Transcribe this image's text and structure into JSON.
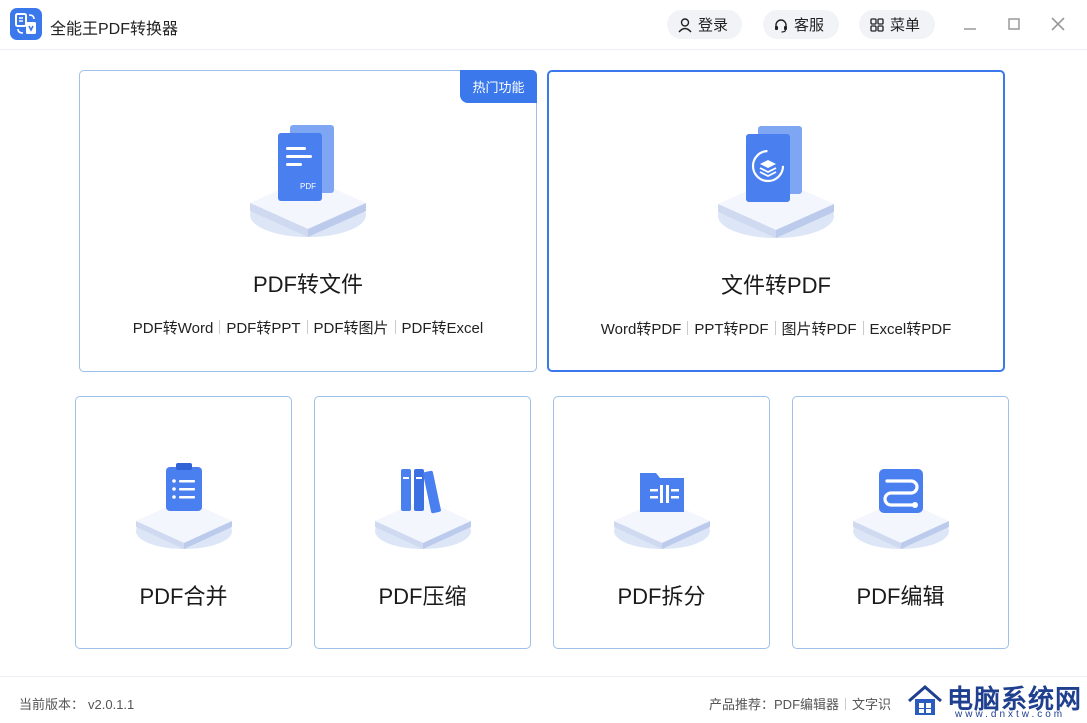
{
  "app": {
    "title": "全能王PDF转换器",
    "accent": "#3a78ec"
  },
  "header": {
    "login_label": "登录",
    "service_label": "客服",
    "menu_label": "菜单"
  },
  "cards": {
    "pdf_to_file": {
      "badge": "热门功能",
      "title": "PDF转文件",
      "links": [
        "PDF转Word",
        "PDF转PPT",
        "PDF转图片",
        "PDF转Excel"
      ]
    },
    "file_to_pdf": {
      "title": "文件转PDF",
      "links": [
        "Word转PDF",
        "PPT转PDF",
        "图片转PDF",
        "Excel转PDF"
      ]
    },
    "merge": {
      "title": "PDF合并",
      "icon": "clipboard-checklist-icon"
    },
    "compress": {
      "title": "PDF压缩",
      "icon": "binders-icon"
    },
    "split": {
      "title": "PDF拆分",
      "icon": "folder-split-icon"
    },
    "edit": {
      "title": "PDF编辑",
      "icon": "edit-path-icon"
    }
  },
  "footer": {
    "version_label": "当前版本：",
    "version": "v2.0.1.1",
    "products_label": "产品推荐：",
    "products": [
      "PDF编辑器",
      "文字识"
    ]
  },
  "watermark": {
    "text": "电脑系统网",
    "url": "www.dnxtw.com"
  }
}
